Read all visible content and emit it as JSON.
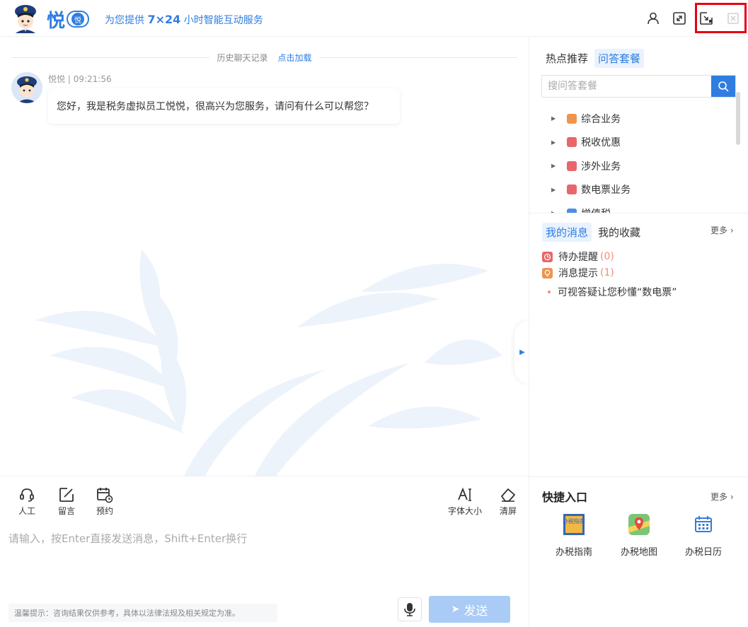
{
  "header": {
    "brand_char": "悦",
    "brand_badge": "悦",
    "tagline_prefix": "为您提供 ",
    "tagline_bold": "7×24",
    "tagline_suffix": " 小时智能互动服务",
    "icons": [
      "user-icon",
      "expand-icon",
      "minimize-icon",
      "close-icon"
    ]
  },
  "chat": {
    "history_label": "历史聊天记录",
    "history_link": "点击加载",
    "messages": [
      {
        "sender": "悦悦",
        "time": "09:21:56",
        "text": "您好，我是税务虚拟员工悦悦，很高兴为您服务，请问有什么可以帮您？"
      }
    ]
  },
  "toolbar": {
    "human": "人工",
    "message": "留言",
    "reserve": "预约",
    "font_size": "字体大小",
    "clear": "清屏"
  },
  "input": {
    "placeholder": "请输入，按Enter直接发送消息，Shift+Enter换行",
    "tip": "温馨提示：咨询结果仅供参考，具体以法律法规及相关规定为准。",
    "send_label": "发送"
  },
  "right": {
    "tabs": [
      {
        "label": "热点推荐",
        "active": false
      },
      {
        "label": "问答套餐",
        "active": true
      }
    ],
    "search_placeholder": "搜问答套餐",
    "tree": [
      {
        "label": "综合业务",
        "color": "#f0944d"
      },
      {
        "label": "税收优惠",
        "color": "#e8666b"
      },
      {
        "label": "涉外业务",
        "color": "#e8666b"
      },
      {
        "label": "数电票业务",
        "color": "#e8666b"
      },
      {
        "label": "增值税",
        "color": "#4a8ee8"
      }
    ],
    "tabs2": [
      {
        "label": "我的消息",
        "active": true
      },
      {
        "label": "我的收藏",
        "active": false
      }
    ],
    "more_label": "更多",
    "todo_label": "待办提醒",
    "todo_count": "(0)",
    "notice_label": "消息提示",
    "notice_count": "(1)",
    "notice_item": "可视答疑让您秒懂“数电票”",
    "quick_title": "快捷入口",
    "quick_more": "更多",
    "quick_items": [
      {
        "label": "办税指南",
        "icon_text": "办税指南"
      },
      {
        "label": "办税地图"
      },
      {
        "label": "办税日历"
      }
    ]
  },
  "colors": {
    "accent": "#2f7de1",
    "send_disabled": "#a9cbf5",
    "highlight": "#e60012"
  }
}
